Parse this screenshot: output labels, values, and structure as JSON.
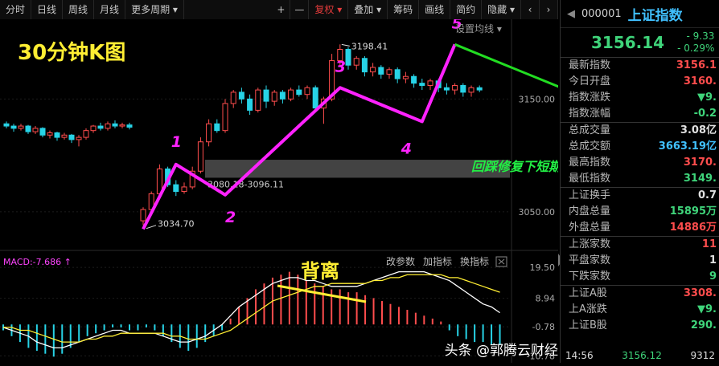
{
  "toolbar": {
    "left_items": [
      "分时",
      "日线",
      "周线",
      "月线",
      "更多周期 ▾"
    ],
    "right_items": [
      "+",
      "—",
      "复权 ▾",
      "叠加 ▾",
      "筹码",
      "画线",
      "简约",
      "隐藏 ▾",
      "‹",
      "›"
    ],
    "active": "复权 ▾",
    "settings_label": "设置均线 ▾"
  },
  "annotations": {
    "title": "30分钟K图",
    "wave_labels": [
      "1",
      "2",
      "3",
      "4",
      "5"
    ],
    "note": "回踩修复下短期均线",
    "divergence": "背离"
  },
  "chart_data": [
    {
      "type": "candlestick",
      "title": "30分钟K图",
      "ylim": [
        3020,
        3215
      ],
      "y_ticks": [
        3050,
        3150
      ],
      "y_tick_labels": [
        "3050.00",
        "3150.00"
      ],
      "high_label": "3198.41",
      "low_label": "3034.70",
      "zone_label": "3080.18-3096.11",
      "zone": [
        3080.18,
        3096.11
      ],
      "wave_points": [
        {
          "label": "",
          "i": 0,
          "y": 3034.7
        },
        {
          "label": "1",
          "i": 4,
          "y": 3092
        },
        {
          "label": "2",
          "i": 10,
          "y": 3065
        },
        {
          "label": "3",
          "i": 24,
          "y": 3160
        },
        {
          "label": "4",
          "i": 34,
          "y": 3130
        },
        {
          "label": "5",
          "i": 38,
          "y": 3198.4
        }
      ],
      "projection": [
        {
          "i": 38,
          "y": 3198.4
        },
        {
          "i": 56,
          "y": 3145
        },
        {
          "i": 68,
          "y": 3175
        },
        {
          "i": 78,
          "y": 3140
        }
      ],
      "candles": [
        {
          "o": 3128,
          "c": 3126,
          "h": 3130,
          "l": 3124
        },
        {
          "o": 3126,
          "c": 3124,
          "h": 3128,
          "l": 3121
        },
        {
          "o": 3124,
          "c": 3126,
          "h": 3128,
          "l": 3122
        },
        {
          "o": 3126,
          "c": 3121,
          "h": 3127,
          "l": 3119
        },
        {
          "o": 3121,
          "c": 3124,
          "h": 3126,
          "l": 3119
        },
        {
          "o": 3124,
          "c": 3118,
          "h": 3125,
          "l": 3116
        },
        {
          "o": 3118,
          "c": 3120,
          "h": 3122,
          "l": 3115
        },
        {
          "o": 3120,
          "c": 3116,
          "h": 3121,
          "l": 3113
        },
        {
          "o": 3116,
          "c": 3118,
          "h": 3120,
          "l": 3114
        },
        {
          "o": 3118,
          "c": 3114,
          "h": 3119,
          "l": 3111
        },
        {
          "o": 3114,
          "c": 3116,
          "h": 3118,
          "l": 3108
        },
        {
          "o": 3116,
          "c": 3122,
          "h": 3124,
          "l": 3114
        },
        {
          "o": 3122,
          "c": 3126,
          "h": 3127,
          "l": 3120
        },
        {
          "o": 3126,
          "c": 3124,
          "h": 3129,
          "l": 3122
        },
        {
          "o": 3124,
          "c": 3128,
          "h": 3130,
          "l": 3122
        },
        {
          "o": 3128,
          "c": 3126,
          "h": 3131,
          "l": 3124
        },
        {
          "o": 3126,
          "c": 3127,
          "h": 3129,
          "l": 3124
        },
        {
          "o": 3127,
          "c": 3125,
          "h": 3129,
          "l": 3123
        },
        {
          "o": 3042,
          "c": 3052,
          "h": 3054,
          "l": 3038
        },
        {
          "o": 3052,
          "c": 3066,
          "h": 3068,
          "l": 3050
        },
        {
          "o": 3066,
          "c": 3088,
          "h": 3092,
          "l": 3064
        },
        {
          "o": 3088,
          "c": 3074,
          "h": 3090,
          "l": 3072
        },
        {
          "o": 3074,
          "c": 3068,
          "h": 3078,
          "l": 3064
        },
        {
          "o": 3068,
          "c": 3072,
          "h": 3076,
          "l": 3066
        },
        {
          "o": 3072,
          "c": 3086,
          "h": 3090,
          "l": 3070
        },
        {
          "o": 3086,
          "c": 3112,
          "h": 3116,
          "l": 3084
        },
        {
          "o": 3112,
          "c": 3128,
          "h": 3132,
          "l": 3108
        },
        {
          "o": 3128,
          "c": 3122,
          "h": 3132,
          "l": 3120
        },
        {
          "o": 3122,
          "c": 3146,
          "h": 3150,
          "l": 3120
        },
        {
          "o": 3146,
          "c": 3156,
          "h": 3158,
          "l": 3142
        },
        {
          "o": 3156,
          "c": 3150,
          "h": 3160,
          "l": 3146
        },
        {
          "o": 3150,
          "c": 3140,
          "h": 3154,
          "l": 3136
        },
        {
          "o": 3140,
          "c": 3158,
          "h": 3160,
          "l": 3138
        },
        {
          "o": 3158,
          "c": 3148,
          "h": 3162,
          "l": 3142
        },
        {
          "o": 3148,
          "c": 3156,
          "h": 3158,
          "l": 3144
        },
        {
          "o": 3156,
          "c": 3150,
          "h": 3158,
          "l": 3146
        },
        {
          "o": 3150,
          "c": 3158,
          "h": 3160,
          "l": 3148
        },
        {
          "o": 3158,
          "c": 3154,
          "h": 3162,
          "l": 3152
        },
        {
          "o": 3154,
          "c": 3160,
          "h": 3162,
          "l": 3150
        },
        {
          "o": 3160,
          "c": 3142,
          "h": 3162,
          "l": 3138
        },
        {
          "o": 3142,
          "c": 3150,
          "h": 3152,
          "l": 3128
        },
        {
          "o": 3150,
          "c": 3184,
          "h": 3190,
          "l": 3148
        },
        {
          "o": 3184,
          "c": 3194,
          "h": 3198.4,
          "l": 3180
        },
        {
          "o": 3194,
          "c": 3180,
          "h": 3196,
          "l": 3176
        },
        {
          "o": 3180,
          "c": 3186,
          "h": 3188,
          "l": 3176
        },
        {
          "o": 3186,
          "c": 3174,
          "h": 3188,
          "l": 3170
        },
        {
          "o": 3174,
          "c": 3178,
          "h": 3182,
          "l": 3170
        },
        {
          "o": 3178,
          "c": 3172,
          "h": 3180,
          "l": 3168
        },
        {
          "o": 3172,
          "c": 3176,
          "h": 3178,
          "l": 3168
        },
        {
          "o": 3176,
          "c": 3168,
          "h": 3178,
          "l": 3164
        },
        {
          "o": 3168,
          "c": 3170,
          "h": 3174,
          "l": 3164
        },
        {
          "o": 3170,
          "c": 3164,
          "h": 3172,
          "l": 3160
        },
        {
          "o": 3164,
          "c": 3162,
          "h": 3168,
          "l": 3158
        },
        {
          "o": 3162,
          "c": 3166,
          "h": 3168,
          "l": 3158
        },
        {
          "o": 3166,
          "c": 3160,
          "h": 3168,
          "l": 3156
        },
        {
          "o": 3160,
          "c": 3158,
          "h": 3164,
          "l": 3154
        },
        {
          "o": 3158,
          "c": 3162,
          "h": 3164,
          "l": 3154
        },
        {
          "o": 3162,
          "c": 3156,
          "h": 3164,
          "l": 3152
        },
        {
          "o": 3156,
          "c": 3160,
          "h": 3162,
          "l": 3152
        },
        {
          "o": 3160,
          "c": 3158,
          "h": 3162,
          "l": 3156
        }
      ],
      "colors": {
        "up": "#ff4d4d",
        "down": "#27d3e6",
        "wave": "#ff22ff",
        "projection": "#22dd22",
        "zone": "#5a5a5a"
      }
    },
    {
      "type": "bar",
      "title": "MACD",
      "indicator_label": "MACD:-7.686 ↑",
      "buttons": [
        "改参数",
        "加指标",
        "换指标"
      ],
      "y_ticks": [
        19.5,
        8.94,
        -0.78,
        -10.78
      ],
      "y_tick_labels": [
        "19.50",
        "8.94",
        "-0.78",
        "-10.78"
      ],
      "ylim": [
        -12,
        22
      ],
      "values": [
        -2,
        -4,
        -6,
        -8,
        -9,
        -10,
        -11,
        -10,
        -8,
        -6,
        -4,
        -3,
        -2,
        -1,
        -1,
        -2,
        -2,
        -1,
        -2,
        -4,
        -6,
        -8,
        -9,
        -8,
        -6,
        -4,
        -2,
        2,
        6,
        9,
        12,
        14,
        16,
        17,
        18,
        17,
        15,
        14,
        13,
        12,
        12,
        11,
        11,
        10,
        9,
        8,
        7,
        6,
        5,
        4,
        3,
        2,
        1,
        -2,
        -4,
        -5,
        -6,
        -6,
        -7,
        -7
      ],
      "dif": [
        -1,
        -2,
        -3,
        -4,
        -6,
        -7,
        -8,
        -8,
        -7,
        -6,
        -5,
        -4,
        -3,
        -2,
        -2,
        -3,
        -3,
        -3,
        -3,
        -4,
        -5,
        -6,
        -6,
        -5,
        -4,
        -2,
        0,
        3,
        6,
        8,
        10,
        12,
        14,
        15,
        16,
        16,
        15,
        15,
        14,
        13,
        13,
        13,
        13,
        14,
        15,
        16,
        17,
        18,
        18,
        18,
        18,
        17,
        16,
        15,
        13,
        11,
        9,
        7,
        6,
        4
      ],
      "dea": [
        -1,
        -1,
        -2,
        -2,
        -3,
        -4,
        -5,
        -6,
        -6,
        -6,
        -5,
        -5,
        -4,
        -4,
        -3,
        -3,
        -3,
        -3,
        -3,
        -3,
        -4,
        -4,
        -5,
        -5,
        -5,
        -4,
        -3,
        -2,
        0,
        2,
        4,
        6,
        8,
        9,
        10,
        11,
        12,
        13,
        13,
        14,
        14,
        14,
        14,
        14,
        15,
        15,
        16,
        16,
        17,
        17,
        17,
        17,
        17,
        16,
        16,
        15,
        14,
        13,
        12,
        11
      ]
    }
  ],
  "panel": {
    "code": "000001",
    "name": "上证指数",
    "price": "3156.14",
    "change": "- 9.33",
    "change_pct": "- 0.29%",
    "rows": [
      {
        "label": "最新指数",
        "value": "3156.1",
        "color": "#ff4d4d"
      },
      {
        "label": "今日开盘",
        "value": "3160.",
        "color": "#ff4d4d"
      },
      {
        "label": "指数涨跌",
        "value": "▼9.",
        "color": "#3fd47a"
      },
      {
        "label": "指数涨幅",
        "value": "-0.2",
        "color": "#3fd47a"
      },
      {
        "label": "总成交量",
        "value": "3.08亿",
        "color": "#e0e0e0"
      },
      {
        "label": "总成交额",
        "value": "3663.19亿",
        "color": "#40c0ff"
      },
      {
        "label": "最高指数",
        "value": "3170.",
        "color": "#ff4d4d"
      },
      {
        "label": "最低指数",
        "value": "3149.",
        "color": "#3fd47a"
      },
      {
        "label": "上证换手",
        "value": "0.7",
        "color": "#e0e0e0"
      },
      {
        "label": "内盘总量",
        "value": "15895万",
        "color": "#3fd47a"
      },
      {
        "label": "外盘总量",
        "value": "14886万",
        "color": "#ff4d4d"
      },
      {
        "label": "上涨家数",
        "value": "11",
        "color": "#ff4d4d"
      },
      {
        "label": "平盘家数",
        "value": "1",
        "color": "#e0e0e0"
      },
      {
        "label": "下跌家数",
        "value": "9",
        "color": "#3fd47a"
      },
      {
        "label": "上证A股",
        "value": "3308.",
        "color": "#ff4d4d"
      },
      {
        "label": "上A涨跌",
        "value": "▼9.",
        "color": "#3fd47a"
      },
      {
        "label": "上证B股",
        "value": "290.",
        "color": "#3fd47a"
      }
    ],
    "footer_time": "14:56",
    "footer_price": "3156.12",
    "footer_vol": "9312"
  },
  "watermark": "头条 @郭腾云财经"
}
